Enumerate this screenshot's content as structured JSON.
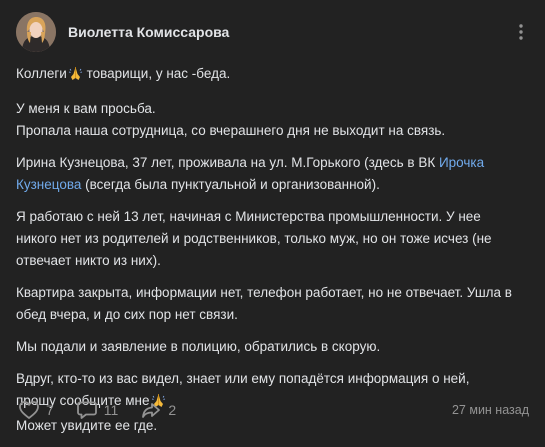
{
  "author": {
    "name": "Виолетта Комиссарова"
  },
  "post": {
    "p1": {
      "a": "Коллеги",
      "b": " товарищи, у нас -беда."
    },
    "p2": {
      "l1": "У меня к вам просьба.",
      "l2": "Пропала наша сотрудница, со вчерашнего дня не выходит на связь."
    },
    "p3": {
      "a": "Ирина Кузнецова, 37 лет, проживала на ул. М.Горького (здесь в ВК ",
      "link": "Ирочка Кузнецова",
      "b": " (всегда была пунктуальной и организованной)."
    },
    "p4": "Я работаю с ней 13 лет, начиная с Министерства промышленности. У нее никого нет из родителей и родственников, только муж, но он тоже исчез (не отвечает никто из них).",
    "p5": "Квартира закрыта, информации нет, телефон работает, но не отвечает. Ушла в обед вчера, и до сих пор нет связи.",
    "p6": "Мы подали и заявление в полицию, обратились в скорую.",
    "p7": {
      "l1": "Вдруг, кто-то из вас видел, знает или ему попадётся информация о ней,",
      "l2": "прошу сообщите мне",
      "l3": "Может увидите ее где."
    }
  },
  "footer": {
    "likes": "7",
    "comments": "11",
    "shares": "2",
    "time": "27 мин назад"
  },
  "icons": {
    "emoji": "folded-hands-icon",
    "more": "more-icon",
    "like": "heart-icon",
    "comment": "comment-icon",
    "share": "share-icon"
  },
  "colors": {
    "background": "#222222",
    "text": "#e1e3e6",
    "link": "#71aaeb",
    "muted": "#939393"
  }
}
